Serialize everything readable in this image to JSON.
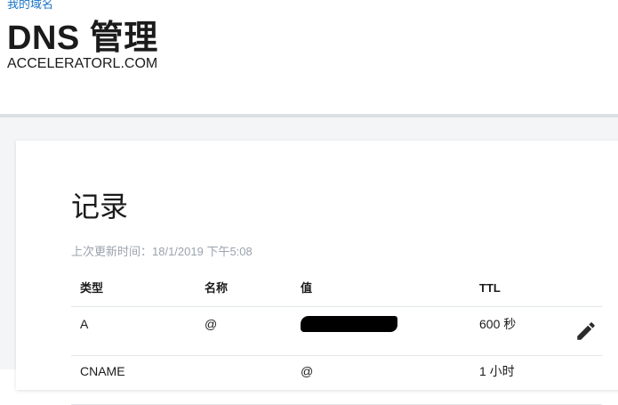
{
  "header": {
    "breadcrumb": "我的域名",
    "title": "DNS 管理",
    "domain": "ACCELERATORL.COM"
  },
  "records": {
    "section_title": "记录",
    "last_updated": "上次更新时间：18/1/2019 下午5:08",
    "columns": [
      "类型",
      "名称",
      "值",
      "TTL"
    ],
    "rows": [
      {
        "type": "A",
        "name": "@",
        "value": "[redacted]",
        "ttl": "600 秒"
      },
      {
        "type": "CNAME",
        "name": "",
        "value": "@",
        "ttl": "1 小时"
      }
    ]
  },
  "colors": {
    "link": "#1a73c8",
    "muted": "#9aa3ad",
    "divider": "#dcdfe3",
    "page_bg": "#f4f5f7"
  },
  "icons": {
    "edit": "pencil-icon"
  }
}
